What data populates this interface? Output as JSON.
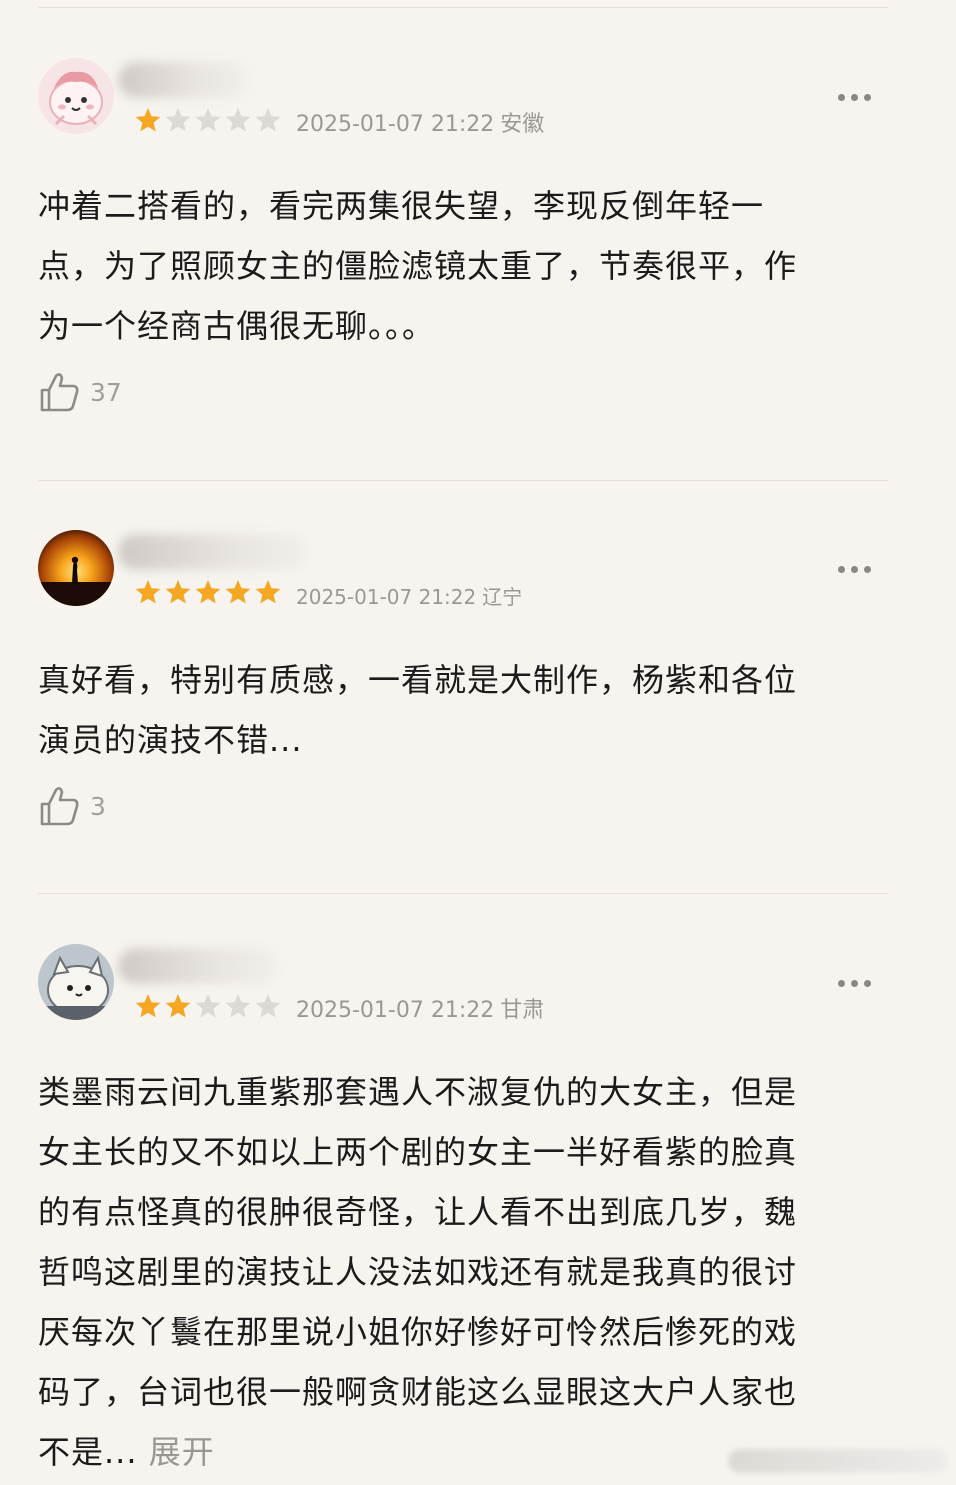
{
  "reviews": [
    {
      "stars": 1,
      "date": "2025-01-07 21:22",
      "location": "安徽",
      "content_lines": [
        "冲着二搭看的，看完两集很失望，李现反倒年轻一",
        "点，为了照顾女主的僵脸滤镜太重了，节奏很平，作",
        "为一个经商古偶很无聊。。。"
      ],
      "likes": "37"
    },
    {
      "stars": 5,
      "date": "2025-01-07 21:22",
      "location": "辽宁",
      "content_lines": [
        "真好看，特别有质感，一看就是大制作，杨紫和各位",
        "演员的演技不错..."
      ],
      "likes": "3"
    },
    {
      "stars": 2,
      "date": "2025-01-07 21:22",
      "location": "甘肃",
      "content_lines": [
        "类墨雨云间九重紫那套遇人不淑复仇的大女主，但是",
        "女主长的又不如以上两个剧的女主一半好看紫的脸真",
        "的有点怪真的很肿很奇怪，让人看不出到底几岁，魏",
        "哲鸣这剧里的演技让人没法如戏还有就是我真的很讨",
        "厌每次丫鬟在那里说小姐你好惨好可怜然后惨死的戏",
        "码了，台词也很一般啊贪财能这么显眼这大户人家也"
      ],
      "last_line": "不是...",
      "expand_label": "展开"
    }
  ],
  "colors": {
    "star_on": "#f5a623",
    "star_off": "#dcdad6"
  }
}
